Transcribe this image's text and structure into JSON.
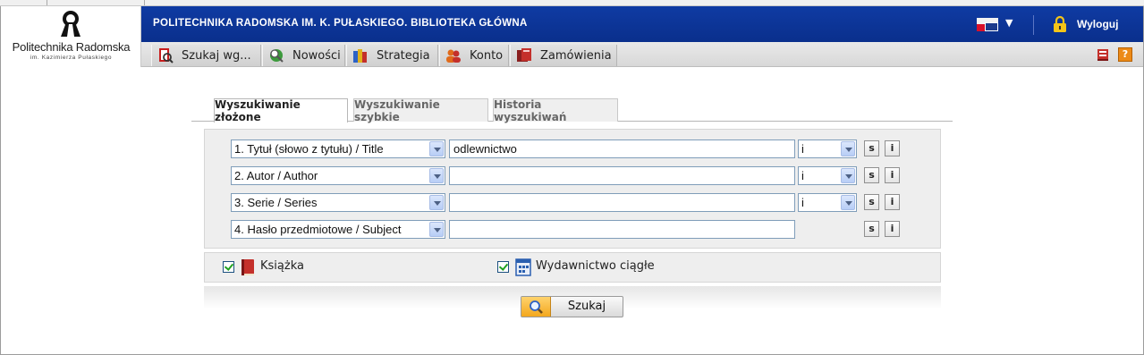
{
  "header": {
    "logo_name": "Politechnika Radomska",
    "logo_subtitle": "im. Kazimierza Pułaskiego",
    "site_title": "POLITECHNIKA RADOMSKA IM. K. PUŁASKIEGO. BIBLIOTEKA GŁÓWNA",
    "logout_label": "Wyloguj",
    "language_caret": "▼"
  },
  "nav": {
    "items": [
      {
        "label": "Szukaj wg...",
        "icon": "search-by-icon"
      },
      {
        "label": "Nowości",
        "icon": "news-icon"
      },
      {
        "label": "Strategia",
        "icon": "strategy-icon"
      },
      {
        "label": "Konto",
        "icon": "account-icon"
      },
      {
        "label": "Zamówienia",
        "icon": "orders-icon"
      }
    ],
    "right_icons": [
      "basket-icon",
      "help-icon"
    ],
    "help_glyph": "?"
  },
  "tabs": [
    {
      "label": "Wyszukiwanie złożone",
      "active": true
    },
    {
      "label": "Wyszukiwanie szybkie",
      "active": false
    },
    {
      "label": "Historia wyszukiwań",
      "active": false
    }
  ],
  "search_rows": [
    {
      "field": "1. Tytuł (słowo z tytułu) / Title",
      "value": "odlewnictwo",
      "operator": "i"
    },
    {
      "field": "2. Autor / Author",
      "value": "",
      "operator": "i"
    },
    {
      "field": "3. Serie / Series",
      "value": "",
      "operator": "i"
    },
    {
      "field": "4. Hasło przedmiotowe / Subject",
      "value": "",
      "operator": null
    }
  ],
  "row_buttons": {
    "s_label": "s",
    "i_label": "i"
  },
  "types": [
    {
      "label": "Książka",
      "checked": true,
      "icon": "book-icon"
    },
    {
      "label": "Wydawnictwo ciągłe",
      "checked": true,
      "icon": "periodical-icon"
    }
  ],
  "search_button": {
    "label": "Szukaj"
  },
  "colors": {
    "topbar": "#0f3ba3",
    "accent": "#f3a71d",
    "checkmark": "#21a121"
  }
}
